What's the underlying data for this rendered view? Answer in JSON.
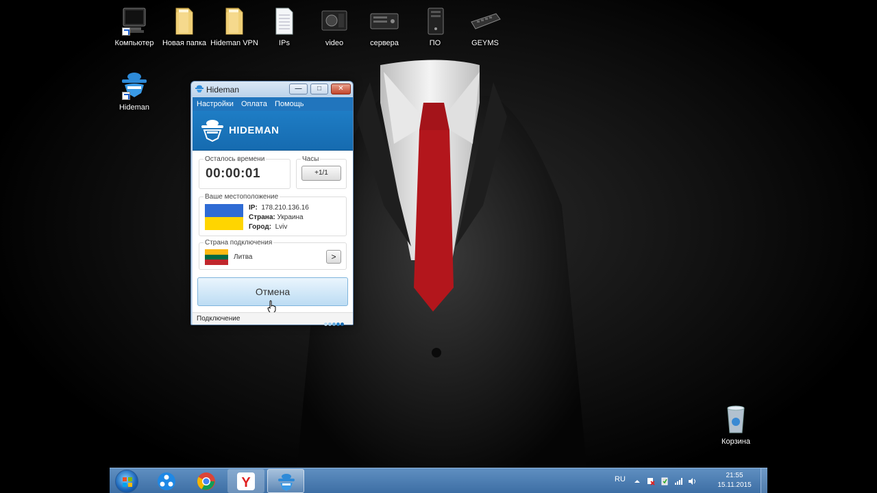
{
  "desktop": {
    "icons": [
      {
        "label": "Компьютер",
        "icon": "computer-icon"
      },
      {
        "label": "Новая папка",
        "icon": "folder-icon"
      },
      {
        "label": "Hideman VPN",
        "icon": "folder-icon"
      },
      {
        "label": "IPs",
        "icon": "text-file-icon"
      },
      {
        "label": "video",
        "icon": "video-card-icon"
      },
      {
        "label": "сервера",
        "icon": "server-icon"
      },
      {
        "label": "ПО",
        "icon": "tower-pc-icon"
      },
      {
        "label": "GEYMS",
        "icon": "keyboard-icon"
      },
      {
        "label": "Hideman",
        "icon": "hideman-app-icon"
      },
      {
        "label": "Корзина",
        "icon": "recycle-bin-icon"
      }
    ]
  },
  "window": {
    "title": "Hideman",
    "menu": [
      "Настройки",
      "Оплата",
      "Помощь"
    ],
    "brand": "HIDEMAN",
    "time_left": {
      "label": "Осталось времени",
      "value": "00:00:01"
    },
    "hours": {
      "label": "Часы",
      "button": "+1/1"
    },
    "location": {
      "label": "Ваше местоположение",
      "ip_label": "IP:",
      "ip": "178.210.136.16",
      "country_label": "Страна:",
      "country": "Украина",
      "city_label": "Город:",
      "city": "Lviv",
      "flag_colors": [
        "#2f6bd4",
        "#ffd500"
      ]
    },
    "connection_country": {
      "label": "Страна подключения",
      "country": "Литва",
      "flag_colors": [
        "#fdb913",
        "#006a44",
        "#c1272d"
      ],
      "next_symbol": ">"
    },
    "action_button": "Отмена",
    "status": "Подключение"
  },
  "taskbar": {
    "language": "RU",
    "time": "21:55",
    "date": "15.11.2015",
    "apps": [
      "start-orb",
      "network-app-icon",
      "chrome-icon",
      "yandex-browser-icon",
      "hideman-app-icon"
    ]
  },
  "colors": {
    "accent": "#2175bd",
    "tie": "#b3161c"
  }
}
